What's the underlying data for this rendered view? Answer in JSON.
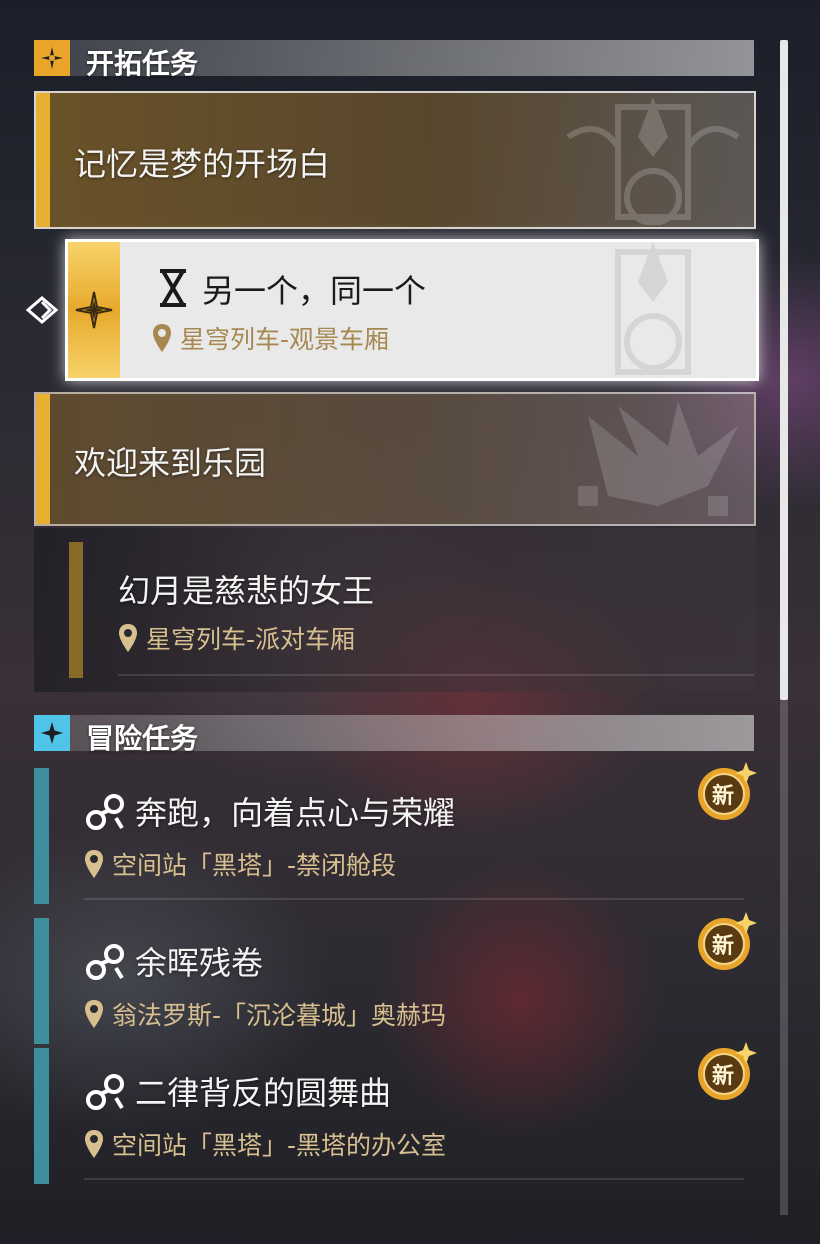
{
  "sections": {
    "trailblaze": {
      "title": "开拓任务"
    },
    "adventure": {
      "title": "冒险任务"
    }
  },
  "trailblaze_quests": [
    {
      "title": "记忆是梦的开场白"
    },
    {
      "title": "另一个，同一个",
      "location": "星穹列车-观景车厢",
      "selected": true
    },
    {
      "title": "欢迎来到乐园"
    },
    {
      "title": "幻月是慈悲的女王",
      "location": "星穹列车-派对车厢"
    }
  ],
  "adventure_quests": [
    {
      "title": "奔跑，向着点心与荣耀",
      "location": "空间站「黑塔」-禁闭舱段",
      "new_label": "新"
    },
    {
      "title": "余晖残卷",
      "location": "翁法罗斯-「沉沦暮城」奥赫玛",
      "new_label": "新"
    },
    {
      "title": "二律背反的圆舞曲",
      "location": "空间站「黑塔」-黑塔的办公室",
      "new_label": "新"
    }
  ],
  "colors": {
    "trailblaze_accent": "#e8b030",
    "adventure_accent": "#3e8ea0",
    "location_text": "#d7bf8f",
    "adventure_badge_bg": "#4fc3e8"
  },
  "icons": {
    "trailblaze_section": "trailblaze-compass-icon",
    "adventure_section": "adventure-star-icon",
    "tracked_quest": "hourglass-icon",
    "selection_pointer": "pointer-arrow-icon",
    "adventure_quest": "adventure-quest-icon",
    "location": "location-pin-icon",
    "new": "new-badge-icon"
  }
}
